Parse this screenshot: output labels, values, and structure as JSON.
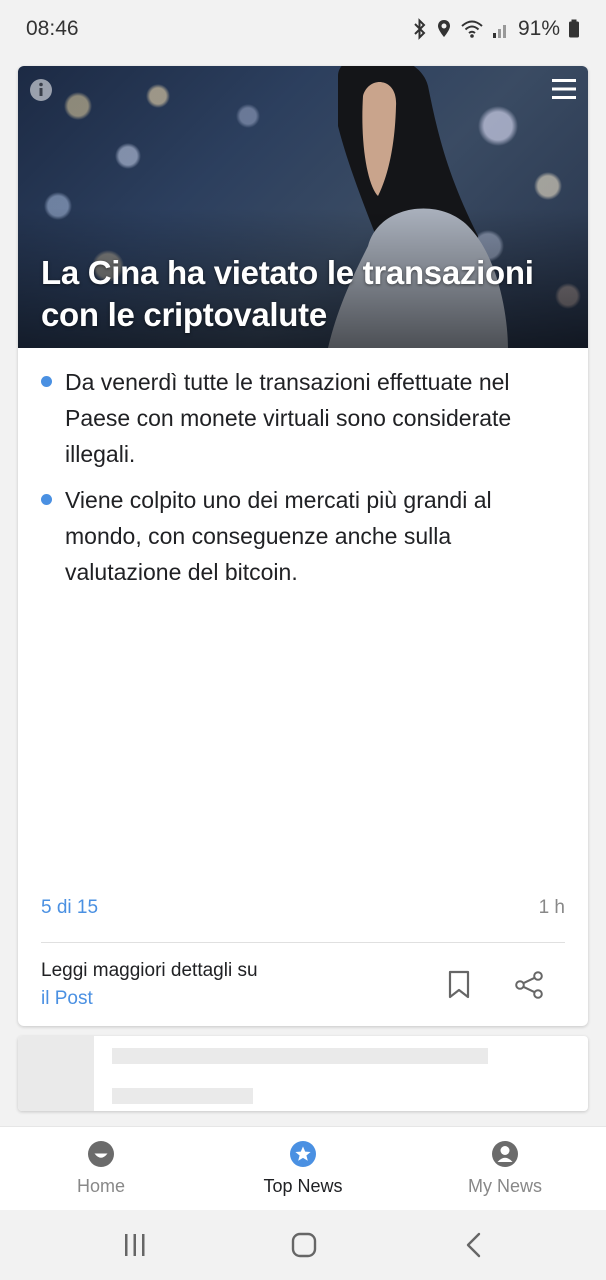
{
  "status_bar": {
    "time": "08:46",
    "battery": "91%"
  },
  "article": {
    "title": "La Cina ha vietato le transazioni con le criptovalute",
    "bullets": [
      "Da venerdì tutte le transazioni effettuate nel Paese con monete virtuali sono considerate illegali.",
      "Viene colpito uno dei mercati più grandi al mondo, con conseguenze anche sulla valutazione del bitcoin."
    ],
    "counter": "5 di 15",
    "age": "1 h",
    "source_label": "Leggi maggiori dettagli su",
    "source_name": "il Post"
  },
  "bottom_nav": {
    "items": [
      {
        "label": "Home",
        "icon": "smile-icon",
        "active": false
      },
      {
        "label": "Top News",
        "icon": "star-icon",
        "active": true
      },
      {
        "label": "My News",
        "icon": "person-icon",
        "active": false
      }
    ]
  },
  "colors": {
    "accent": "#4a90e2",
    "text": "#202124",
    "muted": "#888888"
  }
}
